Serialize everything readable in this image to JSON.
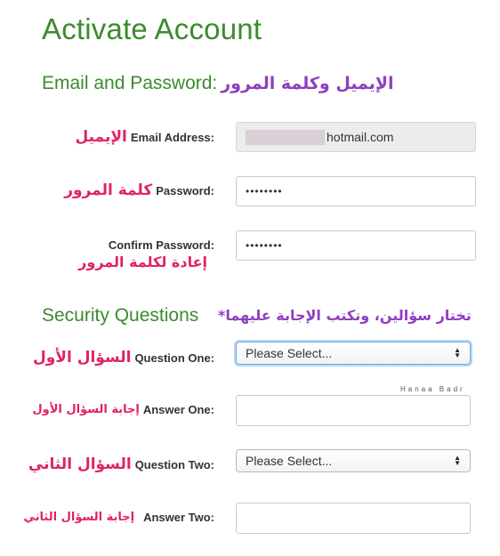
{
  "header": {
    "title": "Activate Account"
  },
  "email_section": {
    "title": "Email and Password:",
    "title_ar": "الإيميل وكلمة المرور"
  },
  "fields": {
    "email": {
      "label": "Email Address:",
      "label_ar": "الإيميل",
      "value_suffix": "hotmail.com"
    },
    "password": {
      "label": "Password:",
      "label_ar": "كلمة المرور",
      "value": "••••••••"
    },
    "confirm_password": {
      "label": "Confirm Password:",
      "label_ar": "إعادة لكلمة المرور",
      "value": "••••••••"
    }
  },
  "security_section": {
    "title": "Security Questions",
    "note_ar": "*تختار سؤالين، وتكتب الإجابة عليهما"
  },
  "questions": {
    "q1": {
      "label": "Question One:",
      "label_ar": "السؤال الأول",
      "selected": "Please Select..."
    },
    "a1": {
      "label": "Answer One:",
      "label_ar": "إجابة السؤال الأول",
      "value": ""
    },
    "q2": {
      "label": "Question Two:",
      "label_ar": "السؤال الثاني",
      "selected": "Please Select..."
    },
    "a2": {
      "label": "Answer Two:",
      "label_ar": "إجابة السؤال الثاني",
      "value": ""
    }
  },
  "watermark": "Hanaa Badr",
  "colors": {
    "heading_green": "#3d8a2e",
    "arabic_purple": "#8e3fbf",
    "arabic_red": "#e0245e",
    "focus_blue": "#6ba6e8"
  }
}
